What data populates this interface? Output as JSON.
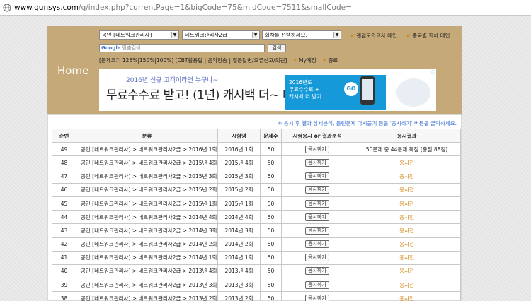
{
  "browser": {
    "url_host": "www.gunsys.com",
    "url_path": "/q/index.php?currentPage=1&bigCode=75&midCode=7511&smallCode="
  },
  "header": {
    "home_label": "Home",
    "select_category": "공인 [네트워크관리사]",
    "select_level": "네트워크관리사2급",
    "select_round": "회차를 선택하세요.",
    "check_random": "랜덤모의고사 메인",
    "check_type": "종목별 회차 메인",
    "search_brand": "Google",
    "search_placeholder": "맞춤검색",
    "search_button": "검색",
    "toolbar_text": "[문제크기 125%|150%|100%] [CBT활용팁 | 음악방송 | 질문답변/오류신고/의견]",
    "check_my": "My계정",
    "check_end": "종료"
  },
  "ad": {
    "line1": "2016년 신규 고객이라면 누구나~",
    "line2": "무료수수료 받고! (1년) 캐시백 더~ 더!",
    "fine_print": "",
    "blue_text": "2016년도\n무료수수료 +\n캐시백 더 받기",
    "go": "GO",
    "info": "ⓘ"
  },
  "notice": "※ 응시 후 결과 상세분석, 틀린문제 다시풀기 등을 '응시하기' 버튼을 클릭하세요.",
  "table": {
    "headers": [
      "순번",
      "분류",
      "시험명",
      "문제수",
      "시험응시 or 결과분석",
      "응시결과"
    ],
    "rows": [
      {
        "no": "49",
        "category": "공인 [네트워크관리사] > 네트워크관리사2급 > 2016년 1회",
        "exam": "2016년 1회",
        "count": "50",
        "action": "응시하기",
        "result": "50문제 중 44문제 득점 (총점 88점)",
        "result_type": "done"
      },
      {
        "no": "48",
        "category": "공인 [네트워크관리사] > 네트워크관리사2급 > 2015년 4회",
        "exam": "2015년 4회",
        "count": "50",
        "action": "응시하기",
        "result": "응시전",
        "result_type": "view"
      },
      {
        "no": "47",
        "category": "공인 [네트워크관리사] > 네트워크관리사2급 > 2015년 3회",
        "exam": "2015년 3회",
        "count": "50",
        "action": "응시하기",
        "result": "응시전",
        "result_type": "view"
      },
      {
        "no": "46",
        "category": "공인 [네트워크관리사] > 네트워크관리사2급 > 2015년 2회",
        "exam": "2015년 2회",
        "count": "50",
        "action": "응시하기",
        "result": "응시전",
        "result_type": "view"
      },
      {
        "no": "45",
        "category": "공인 [네트워크관리사] > 네트워크관리사2급 > 2015년 1회",
        "exam": "2015년 1회",
        "count": "50",
        "action": "응시하기",
        "result": "응시전",
        "result_type": "view"
      },
      {
        "no": "44",
        "category": "공인 [네트워크관리사] > 네트워크관리사2급 > 2014년 4회",
        "exam": "2014년 4회",
        "count": "50",
        "action": "응시하기",
        "result": "응시전",
        "result_type": "view"
      },
      {
        "no": "43",
        "category": "공인 [네트워크관리사] > 네트워크관리사2급 > 2014년 3회",
        "exam": "2014년 3회",
        "count": "50",
        "action": "응시하기",
        "result": "응시전",
        "result_type": "view"
      },
      {
        "no": "42",
        "category": "공인 [네트워크관리사] > 네트워크관리사2급 > 2014년 2회",
        "exam": "2014년 2회",
        "count": "50",
        "action": "응시하기",
        "result": "응시전",
        "result_type": "view"
      },
      {
        "no": "41",
        "category": "공인 [네트워크관리사] > 네트워크관리사2급 > 2014년 1회",
        "exam": "2014년 1회",
        "count": "50",
        "action": "응시하기",
        "result": "응시전",
        "result_type": "view"
      },
      {
        "no": "40",
        "category": "공인 [네트워크관리사] > 네트워크관리사2급 > 2013년 4회",
        "exam": "2013년 4회",
        "count": "50",
        "action": "응시하기",
        "result": "응시전",
        "result_type": "view"
      },
      {
        "no": "39",
        "category": "공인 [네트워크관리사] > 네트워크관리사2급 > 2013년 3회",
        "exam": "2013년 3회",
        "count": "50",
        "action": "응시하기",
        "result": "응시전",
        "result_type": "view"
      },
      {
        "no": "38",
        "category": "공인 [네트워크관리사] > 네트워크관리사2급 > 2013년 2회",
        "exam": "2013년 2회",
        "count": "50",
        "action": "응시하기",
        "result": "응시전",
        "result_type": "view"
      }
    ]
  },
  "colors": {
    "header_bg": "#c6a978",
    "accent_orange": "#d07e00",
    "notice_blue": "#3a6fd0",
    "ad_blue": "#1599d8"
  }
}
